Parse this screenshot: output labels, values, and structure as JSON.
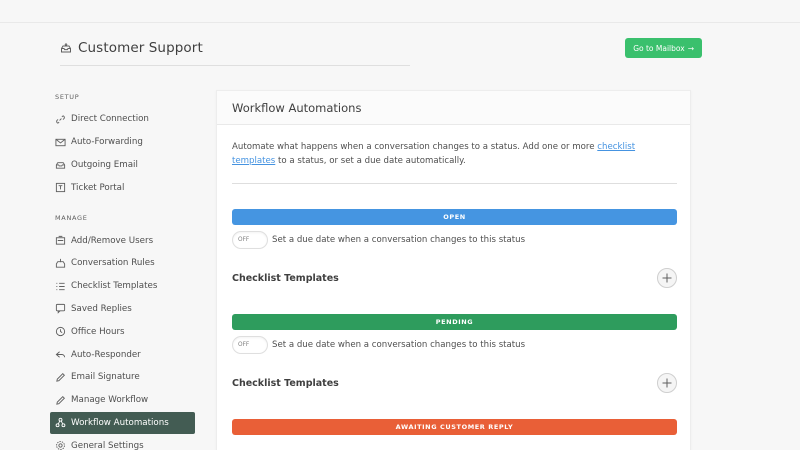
{
  "header": {
    "title": "Customer Support",
    "title_icon": "inbox-icon",
    "mailbox_button": "Go to Mailbox",
    "mailbox_arrow": "→"
  },
  "sidebar": {
    "setup_label": "SETUP",
    "setup_items": [
      {
        "label": "Direct Connection",
        "icon": "link-icon"
      },
      {
        "label": "Auto-Forwarding",
        "icon": "forward-mail-icon"
      },
      {
        "label": "Outgoing Email",
        "icon": "outbox-icon"
      },
      {
        "label": "Ticket Portal",
        "icon": "portal-icon"
      }
    ],
    "manage_label": "MANAGE",
    "manage_items": [
      {
        "label": "Add/Remove Users",
        "icon": "users-icon"
      },
      {
        "label": "Conversation Rules",
        "icon": "rules-icon"
      },
      {
        "label": "Checklist Templates",
        "icon": "checklist-icon"
      },
      {
        "label": "Saved Replies",
        "icon": "saved-replies-icon"
      },
      {
        "label": "Office Hours",
        "icon": "clock-icon"
      },
      {
        "label": "Auto-Responder",
        "icon": "reply-icon"
      },
      {
        "label": "Email Signature",
        "icon": "pen-icon"
      },
      {
        "label": "Manage Workflow",
        "icon": "workflow-icon"
      },
      {
        "label": "Workflow Automations",
        "icon": "automation-icon",
        "active": true
      },
      {
        "label": "General Settings",
        "icon": "gear-icon"
      }
    ]
  },
  "main": {
    "title": "Workflow Automations",
    "intro_before": "Automate what happens when a conversation changes to a status. Add one or more ",
    "intro_link": "checklist templates",
    "intro_after": " to a status, or set a due date automatically.",
    "statuses": [
      {
        "label": "OPEN",
        "color": "#3a8fe0",
        "toggle": "OFF",
        "toggle_text": "Set a due date when a conversation changes to this status",
        "checklist_title": "Checklist Templates"
      },
      {
        "label": "PENDING",
        "color": "#219653",
        "toggle": "OFF",
        "toggle_text": "Set a due date when a conversation changes to this status",
        "checklist_title": "Checklist Templates"
      },
      {
        "label": "AWAITING CUSTOMER REPLY",
        "color": "#e8552b"
      }
    ]
  }
}
